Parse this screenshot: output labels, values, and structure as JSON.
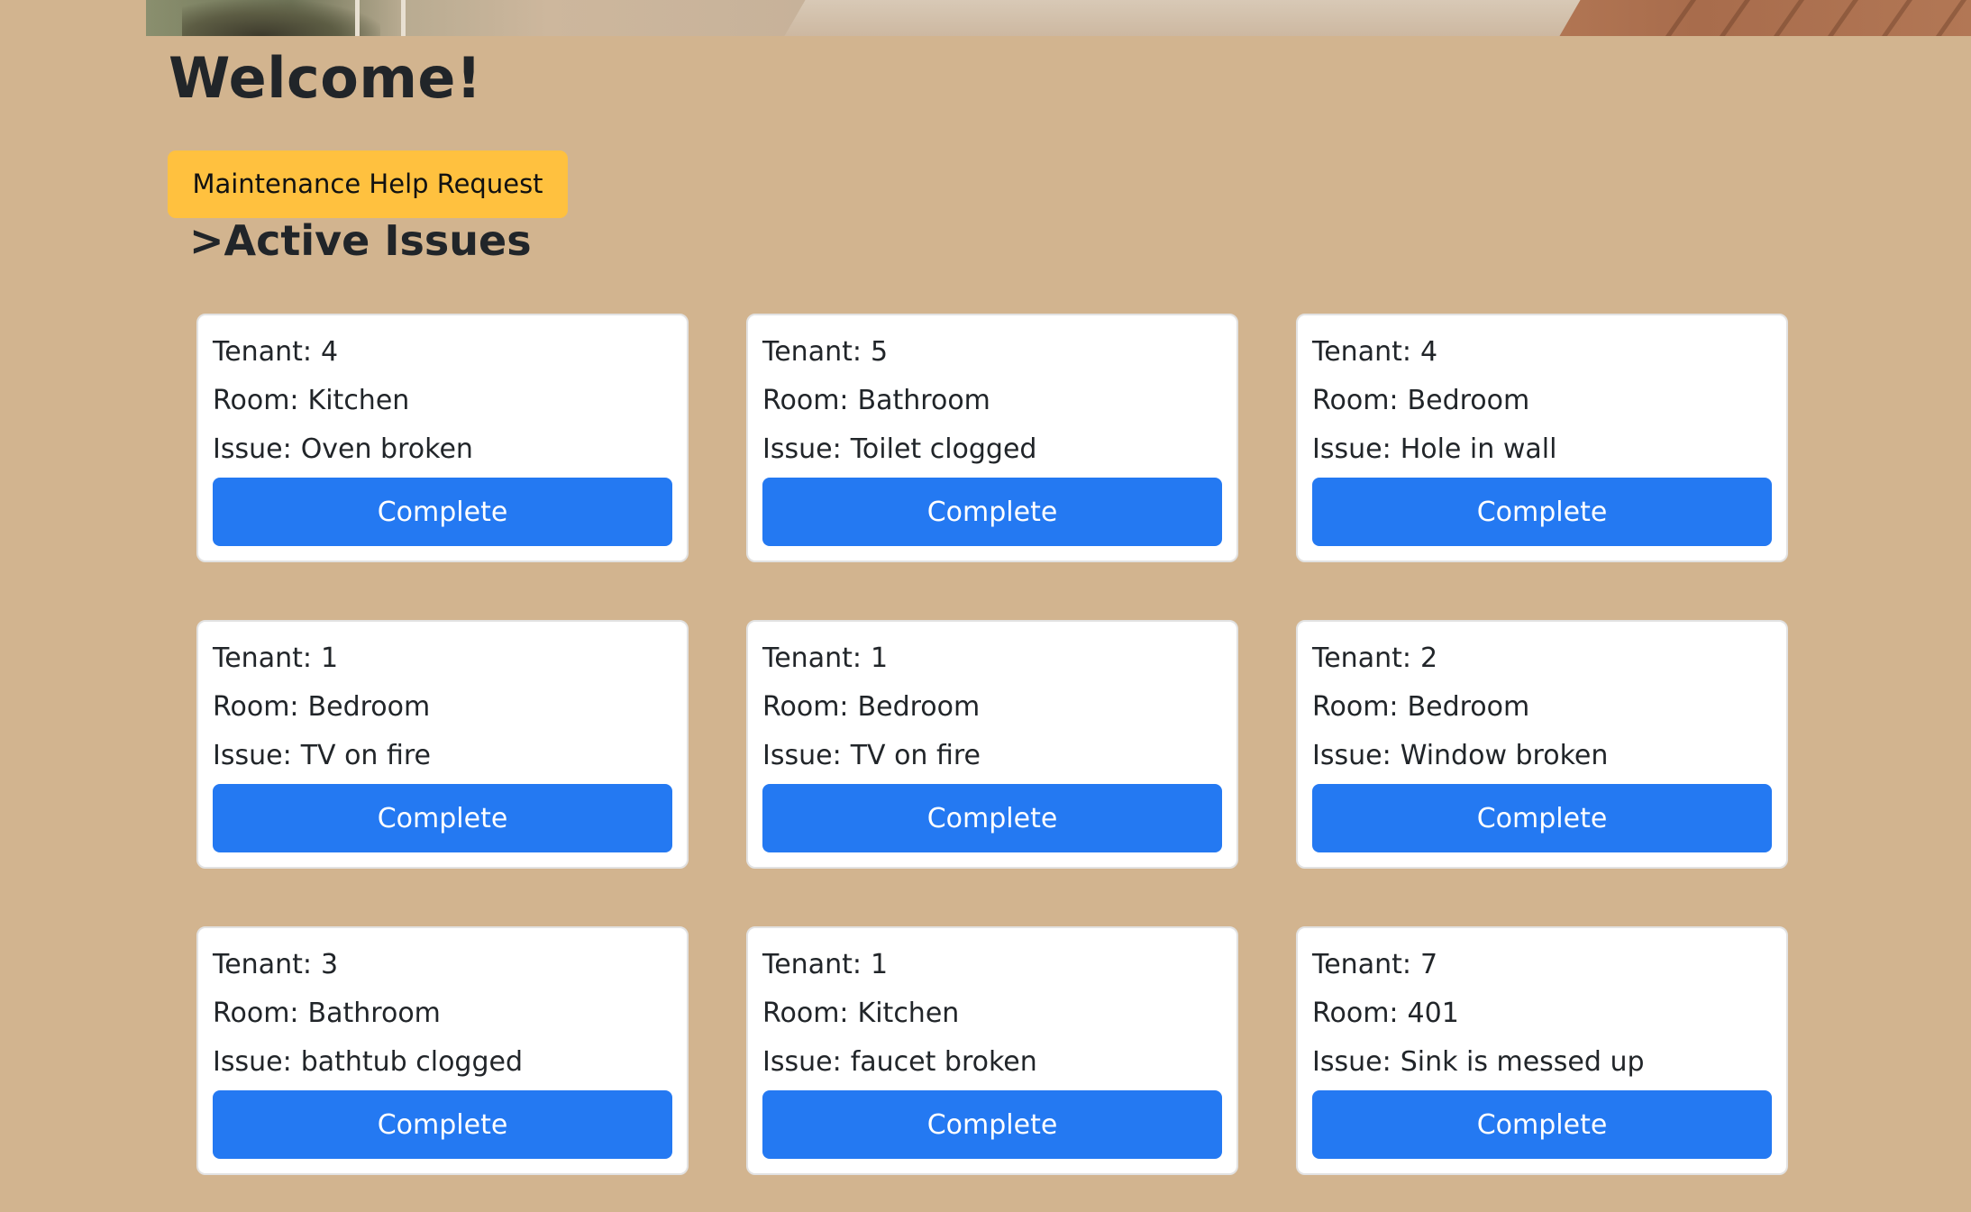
{
  "page": {
    "welcome_title": "Welcome!",
    "help_button_label": "Maintenance Help Request",
    "section_heading": ">Active Issues"
  },
  "card_labels": {
    "tenant": "Tenant:",
    "room": "Room:",
    "issue": "Issue:"
  },
  "issues": [
    {
      "tenant": "4",
      "room": "Kitchen",
      "issue": "Oven broken",
      "button": "Complete"
    },
    {
      "tenant": "5",
      "room": "Bathroom",
      "issue": "Toilet clogged",
      "button": "Complete"
    },
    {
      "tenant": "4",
      "room": "Bedroom",
      "issue": "Hole in wall",
      "button": "Complete"
    },
    {
      "tenant": "1",
      "room": "Bedroom",
      "issue": "TV on fire",
      "button": "Complete"
    },
    {
      "tenant": "1",
      "room": "Bedroom",
      "issue": "TV on fire",
      "button": "Complete"
    },
    {
      "tenant": "2",
      "room": "Bedroom",
      "issue": "Window broken",
      "button": "Complete"
    },
    {
      "tenant": "3",
      "room": "Bathroom",
      "issue": "bathtub clogged",
      "button": "Complete"
    },
    {
      "tenant": "1",
      "room": "Kitchen",
      "issue": "faucet broken",
      "button": "Complete"
    },
    {
      "tenant": "7",
      "room": "401",
      "issue": "Sink is messed up",
      "button": "Complete"
    }
  ],
  "colors": {
    "page_background": "#d2b48f",
    "help_button": "#ffc13f",
    "complete_button": "#2479f2",
    "card_background": "#ffffff"
  }
}
